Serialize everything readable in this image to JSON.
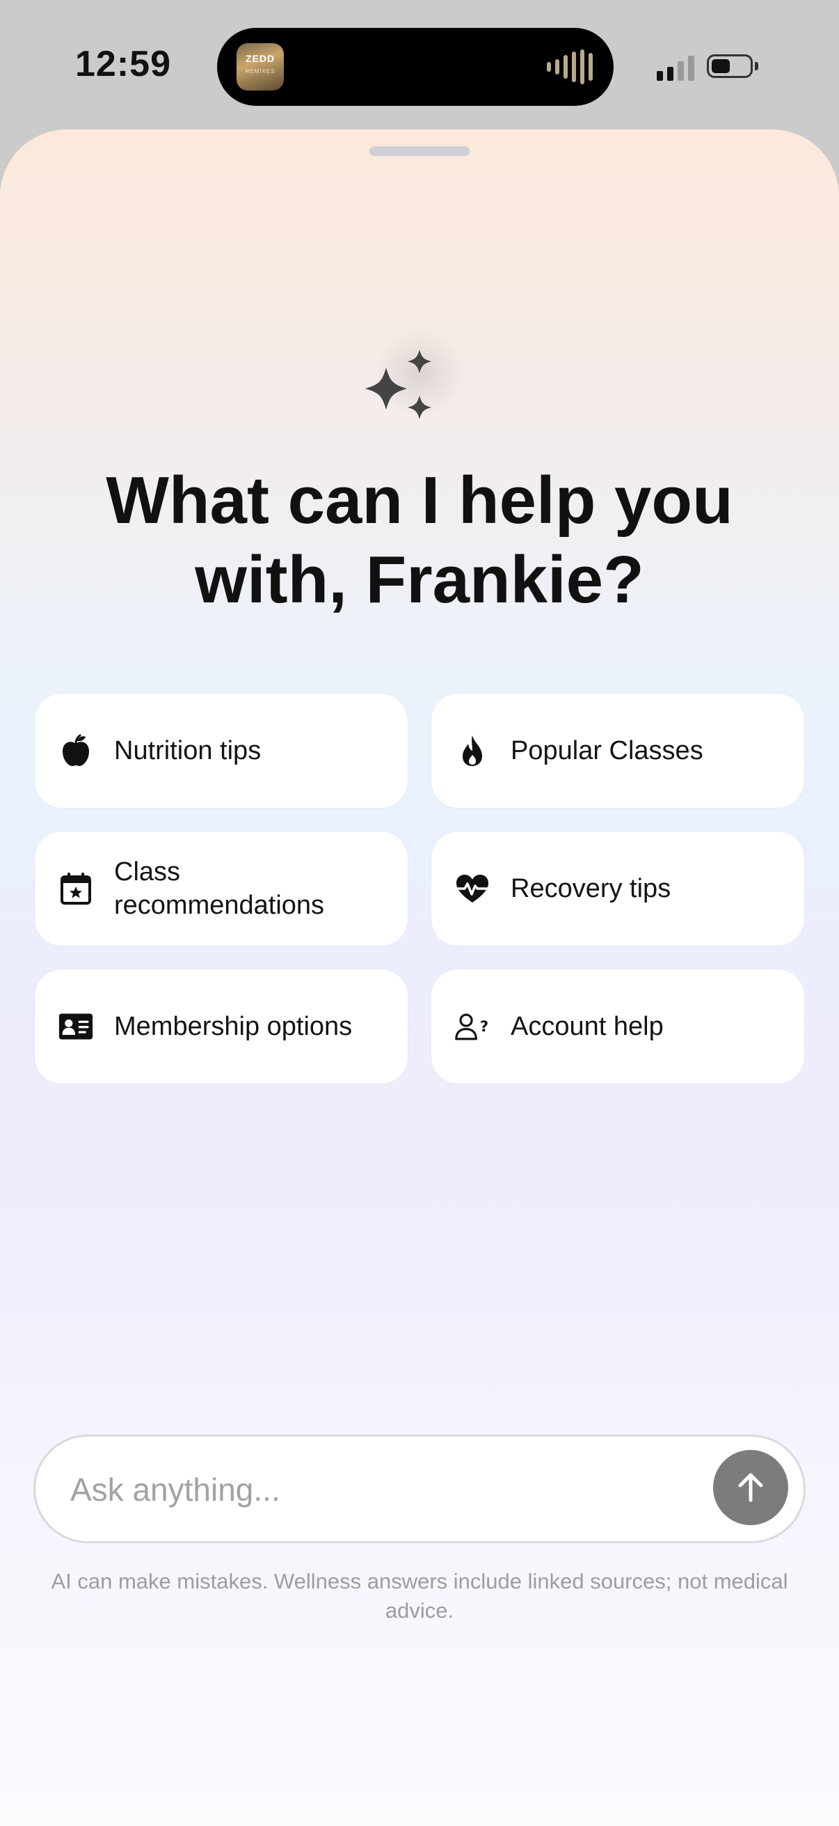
{
  "status_bar": {
    "time": "12:59",
    "now_playing_artwork_text": "ZEDD",
    "now_playing_artwork_subtext": "REMIXES",
    "signal_bars_active": 2,
    "signal_bars_total": 4
  },
  "assistant": {
    "headline": "What can I help you with, Frankie?",
    "quick_actions": [
      {
        "label": "Nutrition tips",
        "icon": "apple-icon"
      },
      {
        "label": "Popular Classes",
        "icon": "flame-icon"
      },
      {
        "label": "Class recommendations",
        "icon": "calendar-star-icon"
      },
      {
        "label": "Recovery tips",
        "icon": "heart-pulse-icon"
      },
      {
        "label": "Membership options",
        "icon": "id-card-icon"
      },
      {
        "label": "Account help",
        "icon": "user-question-icon"
      }
    ]
  },
  "composer": {
    "placeholder": "Ask anything...",
    "value": ""
  },
  "disclaimer": "AI can make mistakes. Wellness answers include linked sources; not medical advice.",
  "colors": {
    "send_button": "#7c7c7c",
    "icon": "#111111",
    "text_primary": "#141414",
    "text_muted": "#9c9ca2"
  }
}
